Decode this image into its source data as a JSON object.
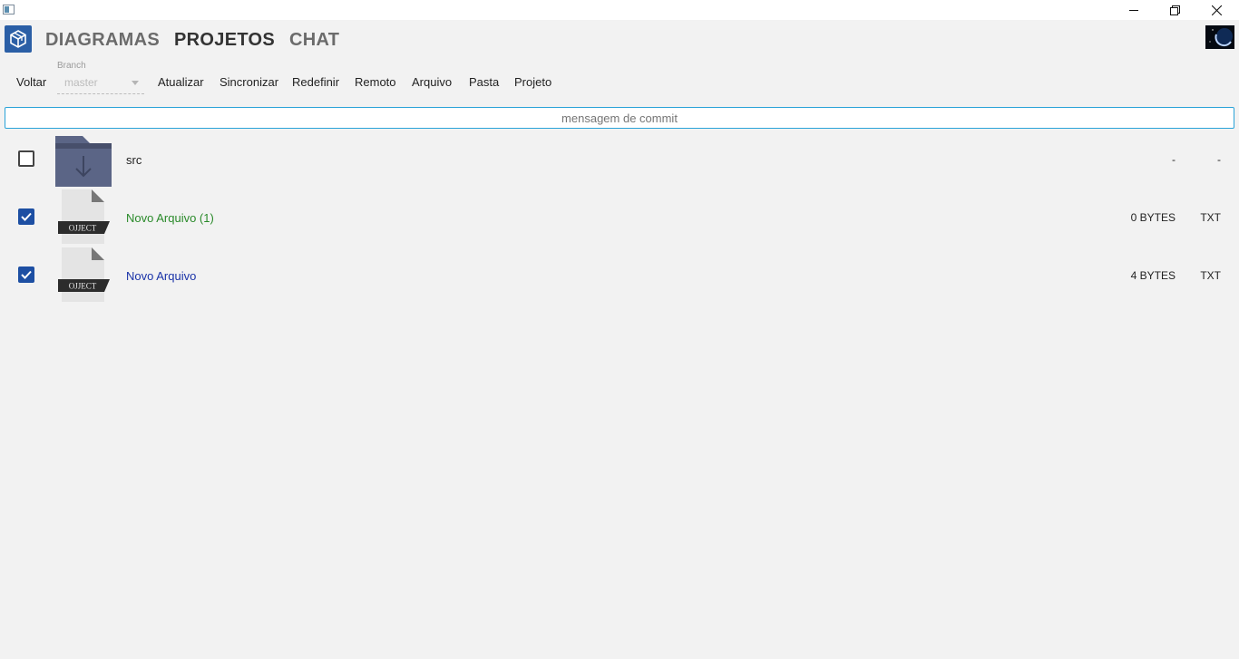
{
  "nav": {
    "tabs": [
      {
        "label": "DIAGRAMAS",
        "active": false
      },
      {
        "label": "PROJETOS",
        "active": true
      },
      {
        "label": "CHAT",
        "active": false
      }
    ]
  },
  "toolbar": {
    "back": "Voltar",
    "branch_label": "Branch",
    "branch_value": "master",
    "update": "Atualizar",
    "sync": "Sincronizar",
    "reset": "Redefinir",
    "remote": "Remoto",
    "file": "Arquivo",
    "folder": "Pasta",
    "project": "Projeto"
  },
  "commit": {
    "placeholder": "mensagem de commit"
  },
  "files": [
    {
      "name": "src",
      "size": "-",
      "type": "-",
      "kind": "folder-icon",
      "checked": false,
      "color": "#222222"
    },
    {
      "name": "Novo Arquivo (1)",
      "size": "0 BYTES",
      "type": "TXT",
      "kind": "file-icon",
      "badge": "OJJECT",
      "checked": true,
      "color": "#2a8a2a"
    },
    {
      "name": "Novo Arquivo",
      "size": "4 BYTES",
      "type": "TXT",
      "kind": "file-icon",
      "badge": "OJJECT",
      "checked": true,
      "color": "#1a33a8"
    }
  ],
  "colors": {
    "accent": "#1d4fa3",
    "logo": "#2b5fa6",
    "commit_border": "#2aa3d8",
    "folder": "#5b6586"
  }
}
